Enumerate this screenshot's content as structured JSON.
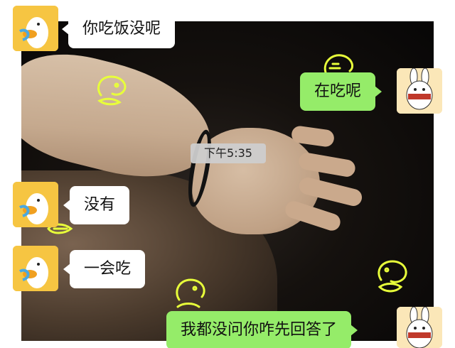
{
  "chat": {
    "timestamp": "下午5:35",
    "messages": [
      {
        "side": "left",
        "text": "你吃饭没呢"
      },
      {
        "side": "right",
        "text": "在吃呢"
      },
      {
        "side": "left",
        "text": "没有"
      },
      {
        "side": "left",
        "text": "一会吃"
      },
      {
        "side": "right",
        "text": "我都没问你咋先回答了"
      }
    ]
  },
  "avatars": {
    "left": "duck-avatar",
    "right": "bunny-avatar"
  },
  "colors": {
    "sent_bubble": "#95ec69",
    "received_bubble": "#ffffff",
    "neon_doodle": "#e8ff3a"
  }
}
